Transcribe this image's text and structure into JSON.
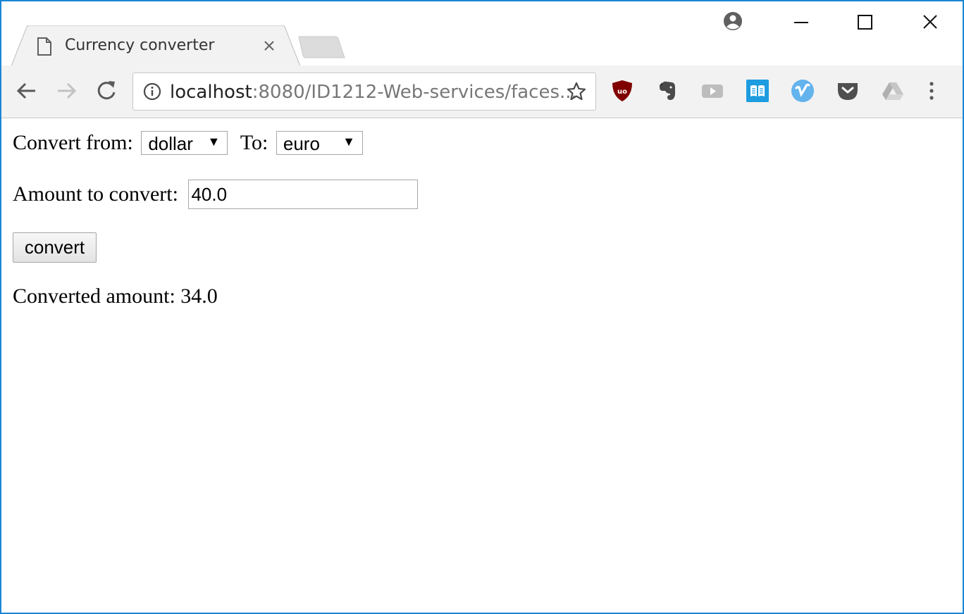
{
  "tab": {
    "title": "Currency converter"
  },
  "address_bar": {
    "host": "localhost",
    "rest": ":8080/ID1212-Web-services/faces..."
  },
  "toolbar": {
    "extensions": [
      "ublock-icon",
      "evernote-icon",
      "youtube-icon",
      "reader-icon",
      "vimeo-icon",
      "pocket-icon",
      "google-drive-icon"
    ]
  },
  "form": {
    "convert_from_label": "Convert from:",
    "from_value": "dollar",
    "to_label": "To:",
    "to_value": "euro",
    "amount_label": "Amount to convert:",
    "amount_value": "40.0",
    "convert_button": "convert",
    "result_label": "Converted amount:",
    "result_value": "34.0"
  },
  "colors": {
    "window_border": "#1a86d6",
    "toolbar_bg": "#f2f2f2"
  }
}
